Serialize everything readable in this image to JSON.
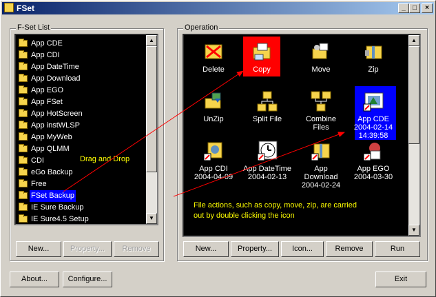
{
  "window": {
    "title": "FSet",
    "controls": {
      "min": "_",
      "max": "□",
      "close": "×"
    }
  },
  "fset_list": {
    "label": "F-Set List",
    "items": [
      {
        "label": "App CDE",
        "selected": false
      },
      {
        "label": "App CDI",
        "selected": false
      },
      {
        "label": "App DateTime",
        "selected": false
      },
      {
        "label": "App Download",
        "selected": false
      },
      {
        "label": "App EGO",
        "selected": false
      },
      {
        "label": "App FSet",
        "selected": false
      },
      {
        "label": "App HotScreen",
        "selected": false
      },
      {
        "label": "App instWLSP",
        "selected": false
      },
      {
        "label": "App MyWeb",
        "selected": false
      },
      {
        "label": "App QLMM",
        "selected": false
      },
      {
        "label": "CDI",
        "selected": false
      },
      {
        "label": "eGo Backup",
        "selected": false
      },
      {
        "label": "Free",
        "selected": false
      },
      {
        "label": "FSet Backup",
        "selected": true
      },
      {
        "label": "IE Sure Backup",
        "selected": false
      },
      {
        "label": "IE Sure4.5 Setup",
        "selected": false
      }
    ],
    "drag_text": "Drag and Drop",
    "buttons": {
      "new": "New...",
      "property": "Property...",
      "remove": "Remove"
    }
  },
  "operation": {
    "label": "Operation",
    "items": [
      {
        "label": "Delete",
        "icon": "delete-icon"
      },
      {
        "label": "Copy",
        "icon": "copy-icon",
        "highlight": "red"
      },
      {
        "label": "Move",
        "icon": "move-icon"
      },
      {
        "label": "Zip",
        "icon": "zip-icon"
      },
      {
        "label": "UnZip",
        "icon": "unzip-icon"
      },
      {
        "label": "Split File",
        "icon": "split-file-icon"
      },
      {
        "label": "Combine Files",
        "icon": "combine-files-icon"
      },
      {
        "label": "App CDE",
        "line2": "2004-02-14",
        "line3": "14:39:58",
        "icon": "app-cde-icon",
        "highlight": "blue"
      },
      {
        "label": "App CDI",
        "line2": "2004-04-09",
        "icon": "app-cdi-icon"
      },
      {
        "label": "App DateTime",
        "line2": "2004-02-13",
        "icon": "clock-icon"
      },
      {
        "label": "App Download",
        "line2": "2004-02-24",
        "icon": "app-download-icon"
      },
      {
        "label": "App EGO",
        "line2": "2004-03-30",
        "icon": "app-ego-icon"
      }
    ],
    "note_line1": "File actions, such as copy, move, zip, are carried",
    "note_line2": "out by double clicking the icon",
    "buttons": {
      "new": "New...",
      "property": "Property...",
      "icon": "Icon...",
      "remove": "Remove",
      "run": "Run"
    }
  },
  "footer": {
    "about": "About...",
    "configure": "Configure...",
    "exit": "Exit"
  },
  "colors": {
    "list_bg": "#000000",
    "selection": "#0000ff",
    "copy_highlight": "#ff0000",
    "arrow": "#ff0000",
    "note": "#ffff00"
  }
}
